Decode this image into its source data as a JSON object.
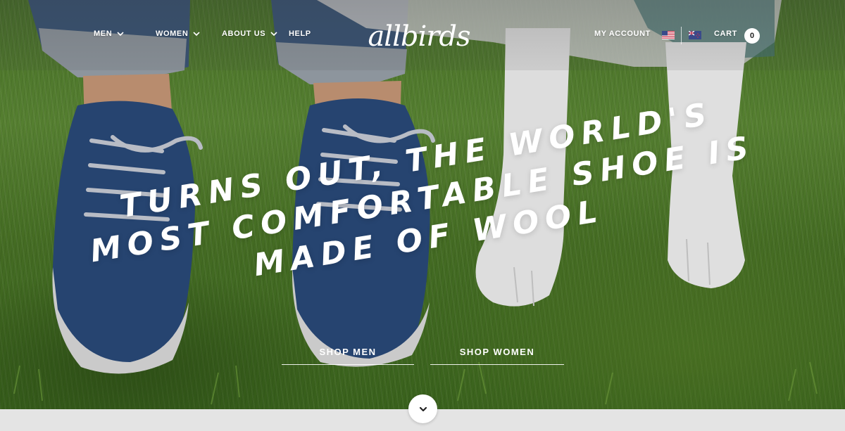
{
  "nav": {
    "men": "MEN",
    "women": "WOMEN",
    "about": "ABOUT US",
    "help": "HELP",
    "logo": "allbirds",
    "account": "MY ACCOUNT",
    "cart": "CART",
    "cart_count": "0",
    "flags": [
      "us-flag-icon",
      "nz-flag-icon"
    ]
  },
  "hero": {
    "headline": "TURNS OUT, THE WORLD'S MOST COMFORTABLE SHOE IS MADE OF WOOL",
    "shop_men": "SHOP MEN",
    "shop_women": "SHOP WOMEN"
  },
  "colors": {
    "grass": "#4d7a2a",
    "shoe": "#2a4a7a",
    "white": "#ffffff"
  }
}
